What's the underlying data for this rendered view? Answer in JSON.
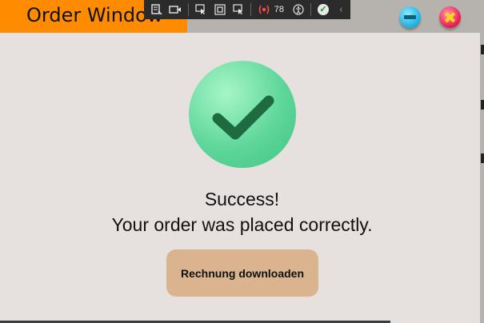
{
  "window": {
    "title": "Order Window",
    "title_bg": "#ff8c00",
    "minimize_icon": "minimize-icon",
    "close_icon": "close-icon"
  },
  "toolbar": {
    "icons": [
      "live-visual-tree-icon",
      "record-icon",
      "select-element-icon",
      "display-layout-adorners-icon",
      "track-focus-icon",
      "accessibility-issues-icon",
      "binding-failures-icon",
      "check-icon",
      "collapse-icon"
    ],
    "issue_count": "78"
  },
  "content": {
    "status_icon": "checkmark-icon",
    "status_color": "#5fd69a",
    "headline": "Success!",
    "message": "Your order was placed correctly.",
    "download_button": "Rechnung downloaden",
    "button_color": "#d9b48e"
  }
}
